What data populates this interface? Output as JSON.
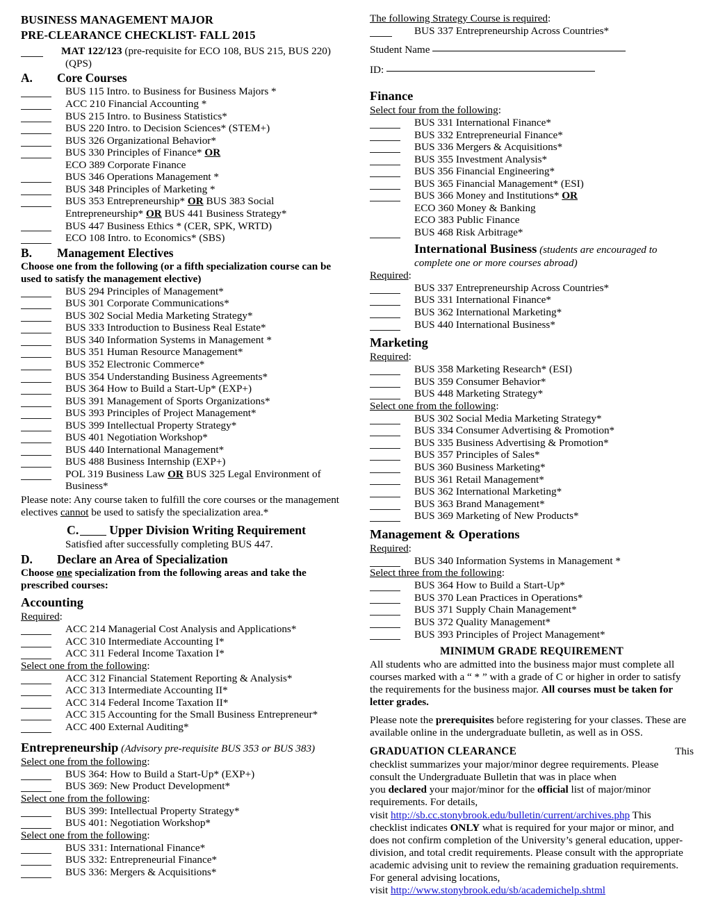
{
  "document": {
    "title_line1": "BUSINESS MANAGEMENT MAJOR",
    "title_line2": "PRE-CLEARANCE CHECKLIST- FALL 2015"
  },
  "left": {
    "mat_requirement": {
      "bold": "MAT 122/123",
      "rest": " (pre-requisite for ECO 108, BUS 215, BUS 220)",
      "cont": "(QPS)"
    },
    "section_a": {
      "letter": "A.",
      "label": "Core Courses",
      "courses": [
        "BUS 115 Intro. to Business for Business Majors *",
        "ACC 210 Financial Accounting *",
        "BUS 215 Intro. to Business Statistics*",
        "BUS 220 Intro. to Decision Sciences* (STEM+)",
        "BUS 326 Organizational Behavior*",
        "BUS 330 Principles of Finance* OR",
        "ECO 389 Corporate Finance",
        "BUS 346 Operations Management *",
        "BUS 348 Principles of Marketing *",
        "BUS 353 Entrepreneurship* OR BUS 383 Social",
        "Entrepreneurship* OR BUS 441 Business Strategy*",
        "BUS 447 Business Ethics * (CER, SPK, WRTD)",
        "ECO 108 Intro. to Economics* (SBS)"
      ]
    },
    "section_b": {
      "letter": "B.",
      "label": "Management Electives",
      "instruction": "Choose one from the following (or a fifth specialization course can be used to satisfy the management elective)",
      "courses": [
        "BUS 294 Principles of Management*",
        "BUS 301 Corporate Communications*",
        "BUS 302 Social Media Marketing Strategy*",
        "BUS 333 Introduction to Business Real Estate*",
        "BUS 340 Information Systems in Management *",
        "BUS 351 Human Resource Management*",
        "BUS 352 Electronic Commerce*",
        "BUS 354 Understanding Business Agreements*",
        "BUS 364 How to Build a Start-Up* (EXP+)",
        "BUS 391 Management of Sports Organizations*",
        "BUS 393 Principles of Project Management*",
        "BUS 399 Intellectual Property Strategy*",
        "BUS 401 Negotiation Workshop*",
        "BUS 440 International Management*",
        "BUS 488 Business Internship (EXP+)",
        "POL 319 Business Law OR BUS 325 Legal Environment of",
        "Business*"
      ],
      "note_part1": "Please note:  Any course taken to fulfill the core courses or the management electives ",
      "note_cannot": "cannot",
      "note_part2": " be used to satisfy the specialization area.*"
    },
    "section_c": {
      "letter": "C.",
      "label": "Upper Division Writing Requirement",
      "detail": "Satisfied after successfully completing BUS 447."
    },
    "section_d": {
      "letter": "D.",
      "label": "Declare an Area of Specialization",
      "instruction_a": "Choose ",
      "instruction_one": "one",
      "instruction_b": " specialization from the following areas and take the prescribed courses:"
    },
    "accounting": {
      "title": "Accounting",
      "required_label": "Required",
      "required_courses": [
        "ACC 214 Managerial Cost Analysis and Applications*",
        "ACC 310 Intermediate Accounting I*",
        "ACC 311 Federal Income Taxation I*"
      ],
      "select_label": "Select one from the following",
      "select_courses": [
        "ACC 312 Financial Statement Reporting & Analysis*",
        "ACC 313 Intermediate Accounting II*",
        "ACC 314 Federal Income Taxation II*",
        "ACC 315 Accounting for the Small Business Entrepreneur*",
        "ACC 400 External Auditing*"
      ]
    },
    "entrepreneurship": {
      "title": "Entrepreneurship",
      "subtitle": " (Advisory pre-requisite BUS 353 or BUS 383)",
      "group1_label": "Select one from the following",
      "group1_courses": [
        "BUS 364: How to Build a Start-Up* (EXP+)",
        "BUS 369: New Product Development*"
      ],
      "group2_label": "Select one from the following",
      "group2_courses": [
        "BUS 399: Intellectual Property Strategy*",
        "BUS 401: Negotiation Workshop*"
      ],
      "group3_label": "Select one from the following",
      "group3_courses": [
        "BUS 331: International Finance*",
        "BUS 332: Entrepreneurial Finance*",
        "BUS 336: Mergers & Acquisitions*"
      ]
    }
  },
  "right": {
    "strategy": {
      "label": "The following Strategy Course is required",
      "course": "BUS 337 Entrepreneurship Across Countries*"
    },
    "form": {
      "student_name_label": "Student Name",
      "id_label": "ID:"
    },
    "finance": {
      "title": "Finance",
      "select_label": "Select four from the following",
      "courses": [
        "BUS 331 International Finance*",
        "BUS 332 Entrepreneurial Finance*",
        "BUS 336 Mergers & Acquisitions*",
        "BUS 355 Investment Analysis*",
        "BUS 356 Financial Engineering*",
        "BUS 365 Financial Management* (ESI)",
        "BUS 366 Money and Institutions* OR",
        "ECO 360 Money & Banking",
        "ECO 383 Public Finance",
        "BUS 468 Risk Arbitrage*"
      ]
    },
    "international_business": {
      "title": "International Business",
      "subtitle": " (students are encouraged to",
      "subtitle_cont": "complete one or more courses abroad)",
      "required_label": "Required",
      "courses": [
        "BUS 337 Entrepreneurship Across Countries*",
        "BUS 331 International Finance*",
        "BUS 362 International Marketing*",
        "BUS 440 International Business*"
      ]
    },
    "marketing": {
      "title": "Marketing",
      "required_label": "Required",
      "required_courses": [
        "BUS 358 Marketing Research* (ESI)",
        "BUS 359 Consumer Behavior*",
        "BUS 448 Marketing Strategy*"
      ],
      "select_label": "Select one from the following",
      "select_courses": [
        "BUS 302 Social Media Marketing Strategy*",
        "BUS 334 Consumer Advertising & Promotion*",
        "BUS 335 Business Advertising & Promotion*",
        "BUS 357 Principles of Sales*",
        "BUS 360 Business Marketing*",
        "BUS 361 Retail Management*",
        "BUS 362 International Marketing*",
        "BUS 363 Brand Management*",
        "BUS 369 Marketing of New Products*"
      ]
    },
    "management_operations": {
      "title": "Management & Operations",
      "required_label": "Required",
      "required_courses": [
        "BUS 340 Information Systems in Management *"
      ],
      "select_label": "Select three from the following",
      "select_courses": [
        "BUS 364 How to Build a Start-Up*",
        "BUS 370 Lean Practices in Operations*",
        "BUS 371 Supply Chain Management*",
        "BUS 372 Quality Management*",
        "BUS 393 Principles of Project Management*"
      ]
    },
    "minimum_grade": {
      "heading": "MINIMUM GRADE REQUIREMENT",
      "body_part1": " All students who are admitted into the business major must complete all courses marked with a “ * ” with a grade of C or higher in order to satisfy the requirements for the business major. ",
      "body_bold": "All courses must be taken for letter grades."
    },
    "prerequisites_note": {
      "part1": "Please note the ",
      "bold": "prerequisites",
      "part2": " before registering for your classes.  These are available online in the undergraduate bulletin, as well as in OSS."
    },
    "graduation": {
      "heading": "GRADUATION CLEARANCE",
      "line1_tail": "This",
      "line2": "checklist summarizes your major/minor degree requirements.  Please",
      "line3": "consult the Undergraduate Bulletin that was in place when",
      "line4_a": "you ",
      "line4_declared": "declared",
      "line4_b": " your major/minor for the ",
      "line4_official": "official",
      "line4_c": " list of major/minor",
      "line5": "requirements.  For details,",
      "line6_visit": "visit ",
      "line6_url": "http://sb.cc.stonybrook.edu/bulletin/current/archives.php",
      "line6_tail": " This",
      "line7_a": "checklist indicates ",
      "line7_only": "ONLY",
      "line7_b": " what is required for your major or minor, and does not confirm completion of the University’s general education, upper-division, and total credit requirements.  Please consult with the appropriate academic advising unit to review the remaining graduation requirements.  For general advising locations,",
      "line8_visit": "visit ",
      "line8_url": "http://www.stonybrook.edu/sb/academichelp.shtml"
    }
  }
}
